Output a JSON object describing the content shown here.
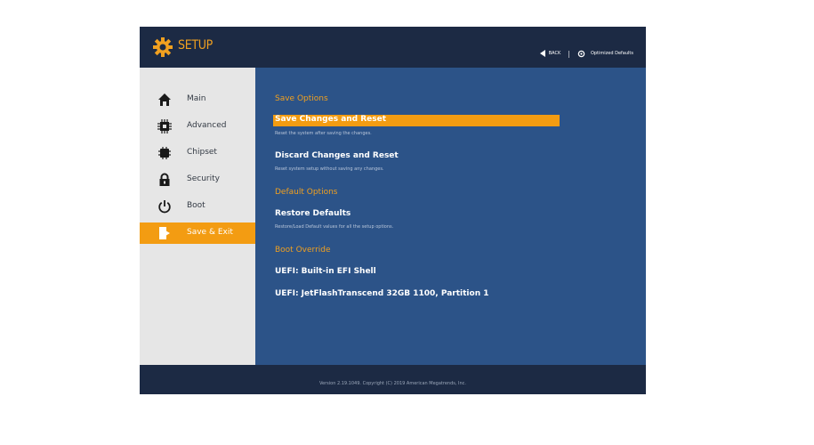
{
  "header": {
    "title": "SETUP",
    "back_label": "BACK",
    "separator": "|",
    "defaults_label": "Optimized Defaults"
  },
  "sidebar": {
    "items": [
      {
        "label": "Main",
        "icon": "home-icon"
      },
      {
        "label": "Advanced",
        "icon": "cpu-icon"
      },
      {
        "label": "Chipset",
        "icon": "chip-icon"
      },
      {
        "label": "Security",
        "icon": "lock-icon"
      },
      {
        "label": "Boot",
        "icon": "power-icon"
      },
      {
        "label": "Save & Exit",
        "icon": "exit-icon",
        "active": true
      }
    ]
  },
  "main": {
    "save_options": {
      "title": "Save Options",
      "items": [
        {
          "label": "Save Changes and Reset",
          "desc": "Reset the system after saving the changes.",
          "selected": true
        },
        {
          "label": "Discard Changes and Reset",
          "desc": "Reset system setup without saving any changes."
        }
      ]
    },
    "default_options": {
      "title": "Default Options",
      "items": [
        {
          "label": "Restore Defaults",
          "desc": "Restore/Load Default values for all the setup options."
        }
      ]
    },
    "boot_override": {
      "title": "Boot Override",
      "items": [
        {
          "label": "UEFI: Built-in EFI Shell"
        },
        {
          "label": "UEFI: JetFlashTranscend 32GB 1100, Partition 1"
        }
      ]
    }
  },
  "footer": {
    "text": "Version 2.19.1049. Copyright (C) 2019 American Megatrends, Inc."
  },
  "colors": {
    "accent": "#f39c12",
    "header_bg": "#1c2a44",
    "content_bg": "#2c5388",
    "sidebar_bg": "#e6e6e6"
  }
}
